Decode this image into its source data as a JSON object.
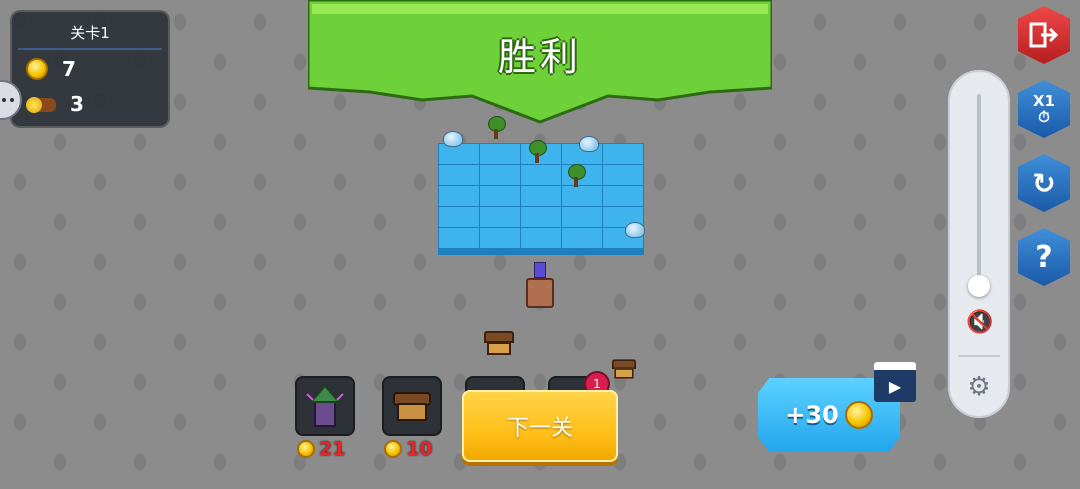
{
  "hud": {
    "level_label": "关卡1",
    "coins": "7",
    "logs": "3"
  },
  "banner": {
    "title": "胜利",
    "color": "#6fd13a"
  },
  "controls": {
    "exit_icon": "exit-icon",
    "speed_label": "X1",
    "restart_icon": "restart-icon",
    "help_label": "?",
    "volume_level": 0.0,
    "muted": true
  },
  "shop": {
    "items": [
      {
        "name": "mage-tower",
        "price": "21"
      },
      {
        "name": "lumber-hut",
        "price": "10"
      },
      {
        "name": "locked-item-3",
        "price": ""
      },
      {
        "name": "locked-item-4",
        "price": ""
      }
    ],
    "badge": "1"
  },
  "next_button": {
    "label": "下一关"
  },
  "ad_reward": {
    "label": "+30"
  }
}
